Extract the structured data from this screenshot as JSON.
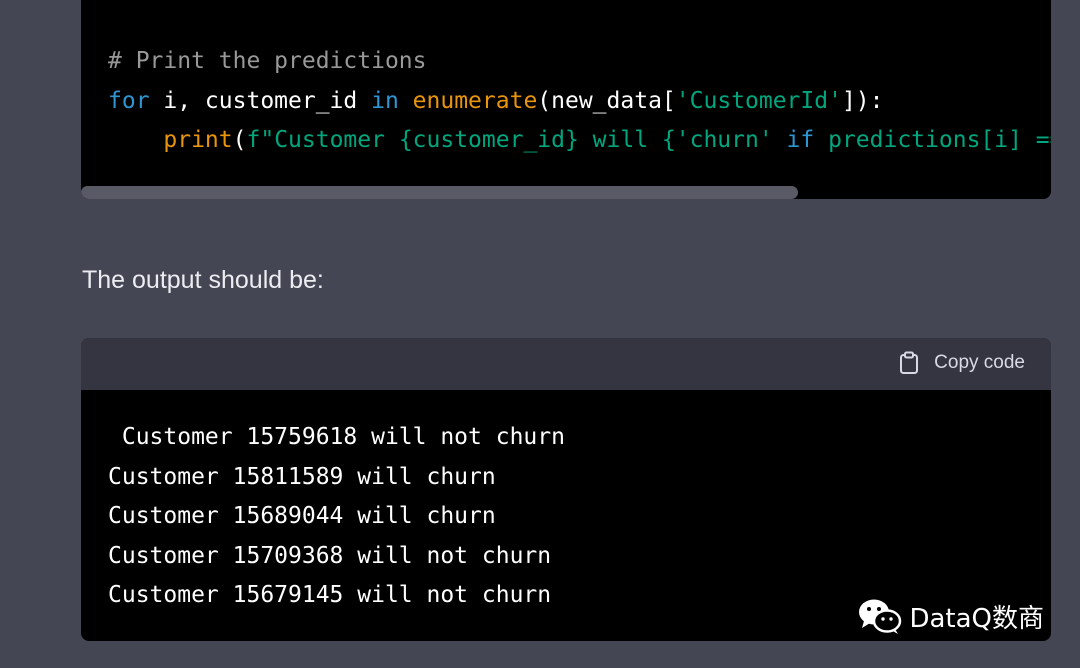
{
  "top_code": {
    "line1": "# Print the predictions",
    "line2": {
      "kw_for": "for",
      "plain1": " i, customer_id ",
      "kw_in": "in",
      "space": " ",
      "fn_enumerate": "enumerate",
      "plain2": "(new_data[",
      "str1": "'CustomerId'",
      "plain3": "]):"
    },
    "line3": {
      "indent": "    ",
      "fn_print": "print",
      "plain1": "(",
      "str1": "f\"Customer {customer_id} will {'churn' ",
      "kw_if": "if",
      "plain2": " predictions[i] ==",
      "rest": ""
    }
  },
  "output_label": "The output should be:",
  "copy_code_label": "Copy code",
  "output_lines": [
    " Customer 15759618 will not churn",
    "Customer 15811589 will churn",
    "Customer 15689044 will churn",
    "Customer 15709368 will not churn",
    "Customer 15679145 will not churn"
  ],
  "watermark": {
    "text": "DataQ数商",
    "icon": "wechat-icon"
  },
  "colors": {
    "background": "#444654",
    "code_bg": "#000000",
    "code_header_bg": "#343541",
    "keyword": "#2e95d3",
    "builtin": "#e9950c",
    "string": "#00a67d",
    "comment": "#999999"
  }
}
